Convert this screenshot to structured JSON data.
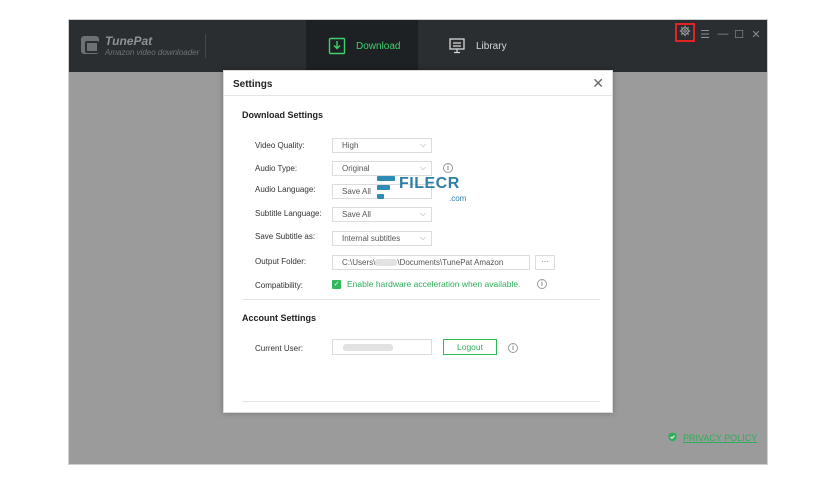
{
  "app": {
    "name": "TunePat",
    "subtitle": "Amazon video downloader",
    "tabs": [
      {
        "label": "Download",
        "active": true,
        "icon": "download-icon"
      },
      {
        "label": "Library",
        "active": false,
        "icon": "library-monitor-icon"
      }
    ],
    "window_controls": [
      "gear-icon",
      "menu-icon",
      "minimize-icon",
      "maximize-icon",
      "close-icon"
    ],
    "privacy_link": "PRIVACY POLICY",
    "accent_color": "#3fd06f",
    "highlight_color": "#e02424"
  },
  "settings": {
    "title": "Settings",
    "download_section": {
      "title": "Download Settings",
      "video_quality": {
        "label": "Video Quality:",
        "value": "High"
      },
      "audio_type": {
        "label": "Audio Type:",
        "value": "Original"
      },
      "audio_language": {
        "label": "Audio Language:",
        "value": "Save All"
      },
      "subtitle_language": {
        "label": "Subtitle Language:",
        "value": "Save All"
      },
      "save_subtitle_as": {
        "label": "Save Subtitle as:",
        "value": "Internal subtitles"
      },
      "output_folder": {
        "label": "Output Folder:",
        "value_prefix": "C:\\Users\\",
        "value_suffix": "\\Documents\\TunePat Amazon",
        "browse_label": "···"
      },
      "compatibility": {
        "label": "Compatibility:",
        "checkbox_label": "Enable hardware acceleration when available.",
        "checked": true
      }
    },
    "account_section": {
      "title": "Account Settings",
      "current_user": {
        "label": "Current User:"
      },
      "logout_label": "Logout"
    }
  },
  "watermark": {
    "brand": "FILECR",
    "suffix": ".com"
  }
}
